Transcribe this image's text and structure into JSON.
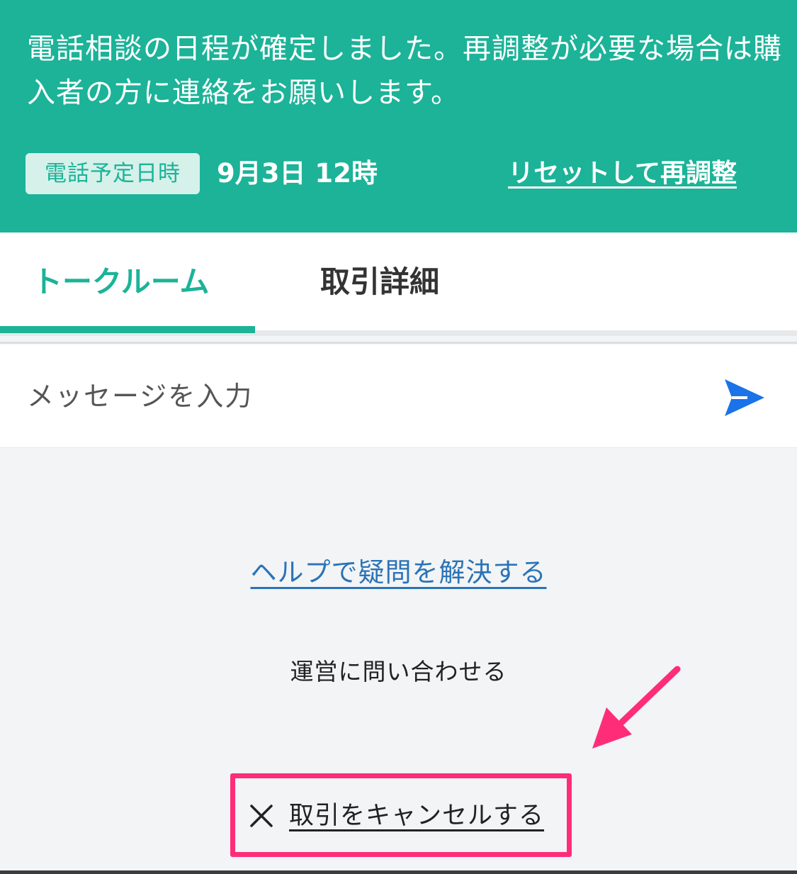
{
  "banner": {
    "message": "電話相談の日程が確定しました。再調整が必要な場合は購入者の方に連絡をお願いします。",
    "schedule_badge": "電話予定日時",
    "schedule_datetime": "9月3日 12時",
    "reset_link": "リセットして再調整",
    "background_color": "#1cb398"
  },
  "tabs": {
    "items": [
      {
        "label": "トークルーム",
        "active": true
      },
      {
        "label": "取引詳細",
        "active": false
      }
    ],
    "active_color": "#1cb398"
  },
  "composer": {
    "placeholder": "メッセージを入力",
    "send_icon": "send-icon",
    "send_color": "#1a73e8"
  },
  "links": {
    "help": "ヘルプで疑問を解決する",
    "contact": "運営に問い合わせる",
    "cancel": "取引をキャンセルする",
    "cancel_icon": "close-icon"
  },
  "annotation": {
    "highlight_color": "#ff2d78",
    "arrow_icon": "pointer-arrow-icon"
  }
}
